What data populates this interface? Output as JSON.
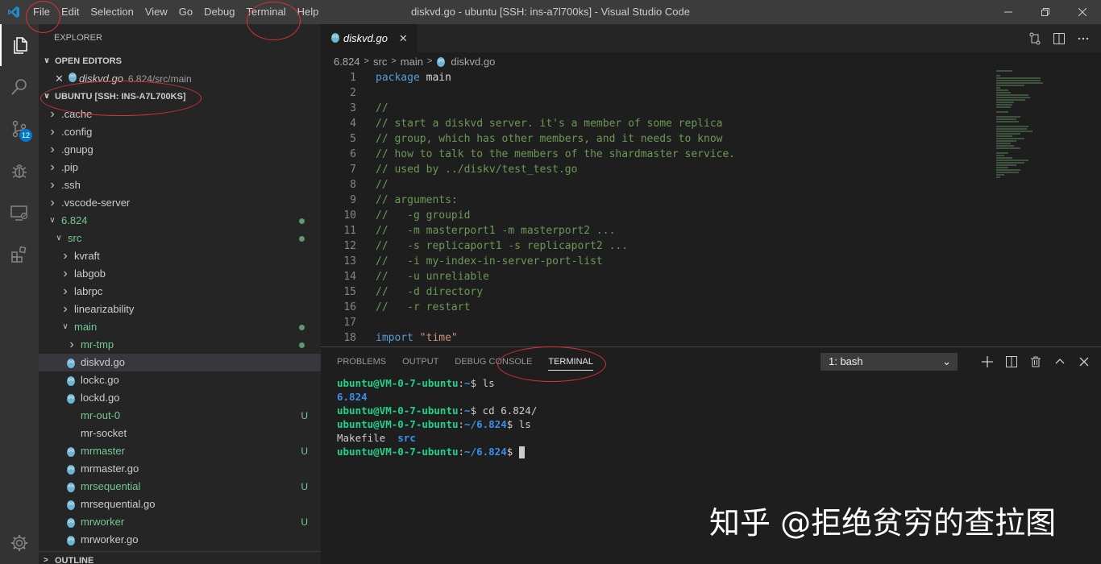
{
  "window": {
    "title": "diskvd.go - ubuntu [SSH: ins-a7l700ks] - Visual Studio Code",
    "menu": [
      "File",
      "Edit",
      "Selection",
      "View",
      "Go",
      "Debug",
      "Terminal",
      "Help"
    ]
  },
  "activity": {
    "source_control_badge": "12"
  },
  "explorer": {
    "title": "EXPLORER",
    "open_editors_label": "OPEN EDITORS",
    "open_editor": {
      "name": "diskvd.go",
      "path": "6.824/src/main"
    },
    "workspace_label": "UBUNTU [SSH: INS-A7L700KS]",
    "tree": [
      {
        "name": ".cache",
        "indent": 1,
        "type": "folder"
      },
      {
        "name": ".config",
        "indent": 1,
        "type": "folder"
      },
      {
        "name": ".gnupg",
        "indent": 1,
        "type": "folder"
      },
      {
        "name": ".pip",
        "indent": 1,
        "type": "folder"
      },
      {
        "name": ".ssh",
        "indent": 1,
        "type": "folder"
      },
      {
        "name": ".vscode-server",
        "indent": 1,
        "type": "folder"
      },
      {
        "name": "6.824",
        "indent": 1,
        "type": "folder-open",
        "green": true,
        "dot": true
      },
      {
        "name": "src",
        "indent": 2,
        "type": "folder-open",
        "green": true,
        "dot": true
      },
      {
        "name": "kvraft",
        "indent": 3,
        "type": "folder"
      },
      {
        "name": "labgob",
        "indent": 3,
        "type": "folder"
      },
      {
        "name": "labrpc",
        "indent": 3,
        "type": "folder"
      },
      {
        "name": "linearizability",
        "indent": 3,
        "type": "folder"
      },
      {
        "name": "main",
        "indent": 3,
        "type": "folder-open",
        "green": true,
        "dot": true
      },
      {
        "name": "mr-tmp",
        "indent": 4,
        "type": "folder",
        "green": true,
        "dot": true
      },
      {
        "name": "diskvd.go",
        "indent": 4,
        "type": "go",
        "selected": true
      },
      {
        "name": "lockc.go",
        "indent": 4,
        "type": "go"
      },
      {
        "name": "lockd.go",
        "indent": 4,
        "type": "go"
      },
      {
        "name": "mr-out-0",
        "indent": 4,
        "type": "file",
        "green": true,
        "status": "U"
      },
      {
        "name": "mr-socket",
        "indent": 4,
        "type": "file"
      },
      {
        "name": "mrmaster",
        "indent": 4,
        "type": "go",
        "green": true,
        "status": "U"
      },
      {
        "name": "mrmaster.go",
        "indent": 4,
        "type": "go"
      },
      {
        "name": "mrsequential",
        "indent": 4,
        "type": "go",
        "green": true,
        "status": "U"
      },
      {
        "name": "mrsequential.go",
        "indent": 4,
        "type": "go"
      },
      {
        "name": "mrworker",
        "indent": 4,
        "type": "go",
        "green": true,
        "status": "U"
      },
      {
        "name": "mrworker.go",
        "indent": 4,
        "type": "go"
      }
    ],
    "outline_label": "OUTLINE"
  },
  "editor": {
    "tab": "diskvd.go",
    "breadcrumb": [
      "6.824",
      "src",
      "main",
      "diskvd.go"
    ],
    "lines": [
      {
        "n": "1",
        "parts": [
          {
            "t": "package",
            "c": "kw"
          },
          {
            "t": " main",
            "c": "pl"
          }
        ]
      },
      {
        "n": "2",
        "parts": []
      },
      {
        "n": "3",
        "parts": [
          {
            "t": "//",
            "c": "cm"
          }
        ]
      },
      {
        "n": "4",
        "parts": [
          {
            "t": "// start a diskvd server. it's a member of some replica",
            "c": "cm"
          }
        ]
      },
      {
        "n": "5",
        "parts": [
          {
            "t": "// group, which has other members, and it needs to know",
            "c": "cm"
          }
        ]
      },
      {
        "n": "6",
        "parts": [
          {
            "t": "// how to talk to the members of the shardmaster service.",
            "c": "cm"
          }
        ]
      },
      {
        "n": "7",
        "parts": [
          {
            "t": "// used by ../diskv/test_test.go",
            "c": "cm"
          }
        ]
      },
      {
        "n": "8",
        "parts": [
          {
            "t": "//",
            "c": "cm"
          }
        ]
      },
      {
        "n": "9",
        "parts": [
          {
            "t": "// arguments:",
            "c": "cm"
          }
        ]
      },
      {
        "n": "10",
        "parts": [
          {
            "t": "//   -g groupid",
            "c": "cm"
          }
        ]
      },
      {
        "n": "11",
        "parts": [
          {
            "t": "//   -m masterport1 -m masterport2 ...",
            "c": "cm"
          }
        ]
      },
      {
        "n": "12",
        "parts": [
          {
            "t": "//   -s replicaport1 -s replicaport2 ...",
            "c": "cm"
          }
        ]
      },
      {
        "n": "13",
        "parts": [
          {
            "t": "//   -i my-index-in-server-port-list",
            "c": "cm"
          }
        ]
      },
      {
        "n": "14",
        "parts": [
          {
            "t": "//   -u unreliable",
            "c": "cm"
          }
        ]
      },
      {
        "n": "15",
        "parts": [
          {
            "t": "//   -d directory",
            "c": "cm"
          }
        ]
      },
      {
        "n": "16",
        "parts": [
          {
            "t": "//   -r restart",
            "c": "cm"
          }
        ]
      },
      {
        "n": "17",
        "parts": []
      },
      {
        "n": "18",
        "parts": [
          {
            "t": "import",
            "c": "kw"
          },
          {
            "t": " ",
            "c": "pl"
          },
          {
            "t": "\"time\"",
            "c": "str"
          }
        ]
      }
    ]
  },
  "panel": {
    "tabs": [
      "PROBLEMS",
      "OUTPUT",
      "DEBUG CONSOLE",
      "TERMINAL"
    ],
    "active_tab": "TERMINAL",
    "terminal_select": "1: bash",
    "terminal_lines": [
      [
        {
          "t": "ubuntu@VM-0-7-ubuntu",
          "c": "t-green"
        },
        {
          "t": ":",
          "c": ""
        },
        {
          "t": "~",
          "c": "t-blue"
        },
        {
          "t": "$ ls",
          "c": ""
        }
      ],
      [
        {
          "t": "6.824",
          "c": "t-blue"
        }
      ],
      [
        {
          "t": "ubuntu@VM-0-7-ubuntu",
          "c": "t-green"
        },
        {
          "t": ":",
          "c": ""
        },
        {
          "t": "~",
          "c": "t-blue"
        },
        {
          "t": "$ cd 6.824/",
          "c": ""
        }
      ],
      [
        {
          "t": "ubuntu@VM-0-7-ubuntu",
          "c": "t-green"
        },
        {
          "t": ":",
          "c": ""
        },
        {
          "t": "~/6.824",
          "c": "t-blue"
        },
        {
          "t": "$ ls",
          "c": ""
        }
      ],
      [
        {
          "t": "Makefile  ",
          "c": ""
        },
        {
          "t": "src",
          "c": "t-blue"
        }
      ],
      [
        {
          "t": "ubuntu@VM-0-7-ubuntu",
          "c": "t-green"
        },
        {
          "t": ":",
          "c": ""
        },
        {
          "t": "~/6.824",
          "c": "t-blue"
        },
        {
          "t": "$ ",
          "c": ""
        }
      ]
    ]
  },
  "watermark": "知乎 @拒绝贫穷的查拉图",
  "colors": {
    "accent": "#007acc",
    "annotation": "#d9303a",
    "git_green": "#73c991"
  }
}
